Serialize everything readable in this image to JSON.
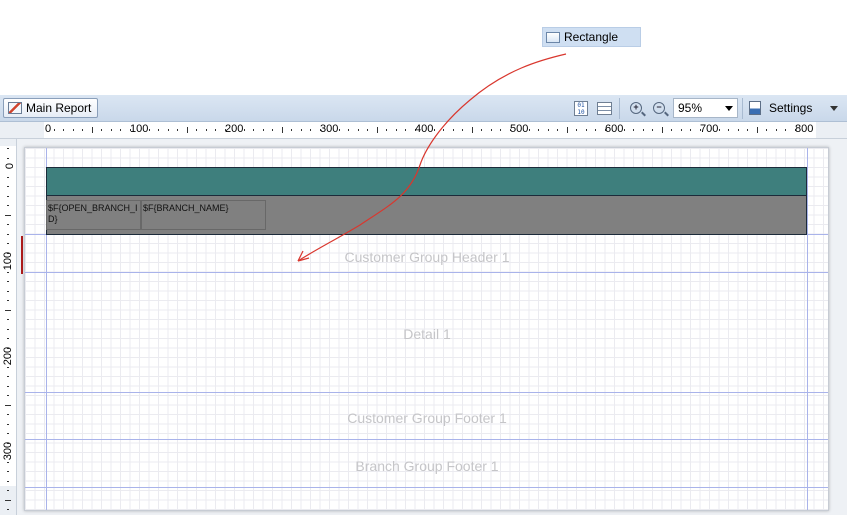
{
  "drag_ghost": {
    "label": "Rectangle",
    "icon": "rectangle-icon"
  },
  "toolbar": {
    "tab_label": "Main Report",
    "tab_icon": "report-icon",
    "field_codes_icon": "field-codes-icon",
    "bands_icon": "bands-icon",
    "zoom_in_icon": "zoom-in-icon",
    "zoom_out_icon": "zoom-out-icon",
    "zoom_value": "95%",
    "settings_label": "Settings",
    "settings_icon": "settings-icon",
    "background_color": "#d3e0ef"
  },
  "ruler": {
    "horizontal_labels": [
      "0",
      "100",
      "200",
      "300",
      "400",
      "500",
      "600",
      "700",
      "800"
    ],
    "vertical_labels": [
      "0",
      "100",
      "200",
      "300"
    ]
  },
  "designer": {
    "header_band_color": "#3e7f7d",
    "detail_band_color": "#808080",
    "fields": [
      {
        "text": "$F{OPEN_BRANCH_ID}"
      },
      {
        "text": "$F{BRANCH_NAME}"
      }
    ],
    "bands": [
      "Customer Group Header 1",
      "Detail 1",
      "Customer Group Footer 1",
      "Branch Group Footer 1"
    ],
    "band_line_color": "#a9b3ea",
    "drag_arrow_color": "#d9372e"
  }
}
